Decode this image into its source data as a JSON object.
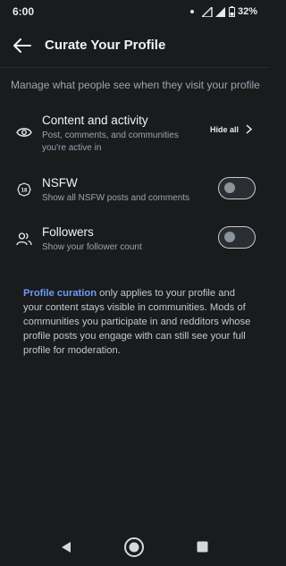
{
  "status": {
    "time": "6:00",
    "battery": "32%"
  },
  "header": {
    "title": "Curate Your Profile"
  },
  "subtitle": "Manage what people see when they visit your profile",
  "settings": [
    {
      "label": "Content and activity",
      "desc": "Post, comments, and communities you're active in",
      "action": "Hide all",
      "icon": "eye-icon"
    },
    {
      "label": "NSFW",
      "desc": "Show all NSFW posts and comments",
      "toggle": false,
      "icon": "nsfw-18-icon"
    },
    {
      "label": "Followers",
      "desc": "Show your follower count",
      "toggle": false,
      "icon": "users-icon"
    }
  ],
  "note": {
    "link": "Profile curation",
    "text": " only applies to your profile and your content stays visible in communities. Mods of communities you participate in and redditors whose profile posts you engage with can still see your full profile for moderation."
  },
  "colors": {
    "background": "#1a1b1d",
    "link": "#6f9bf5"
  }
}
